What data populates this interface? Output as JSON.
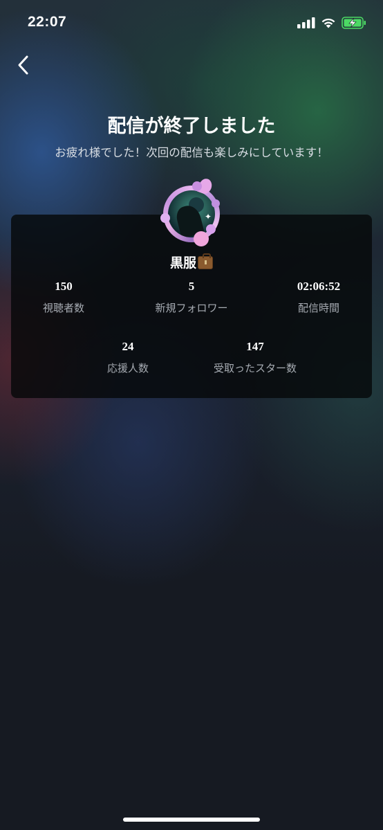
{
  "status_bar": {
    "time": "22:07",
    "icons": [
      "signal-icon",
      "wifi-icon",
      "battery-charging-icon"
    ],
    "battery_color": "#4cd964"
  },
  "nav": {
    "back_icon": "chevron-left-icon"
  },
  "header": {
    "title": "配信が終了しました",
    "subtitle": "お疲れ様でした！次回の配信も楽しみにしています！"
  },
  "profile": {
    "username": "黒服",
    "badge_icon": "briefcase-icon"
  },
  "stats": [
    {
      "value": "150",
      "label": "視聴者数"
    },
    {
      "value": "5",
      "label": "新規フォロワー"
    },
    {
      "value": "02:06:52",
      "label": "配信時間"
    },
    {
      "value": "24",
      "label": "応援人数"
    },
    {
      "value": "147",
      "label": "受取ったスター数"
    }
  ],
  "colors": {
    "card_background": "#06080a",
    "label_gray": "#a6abb2",
    "avatar_frame": "#e9b6ef"
  }
}
